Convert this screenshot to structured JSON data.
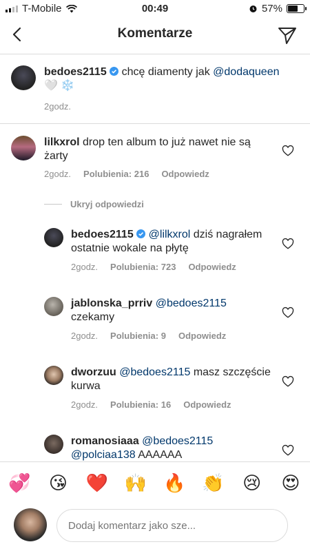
{
  "status_bar": {
    "carrier": "T-Mobile",
    "time": "00:49",
    "battery": "57%"
  },
  "header": {
    "title": "Komentarze"
  },
  "caption": {
    "username": "bedoes2115",
    "text": "chcę diamenty jak",
    "mention": "@dodaqueen",
    "emojis": "🤍 ❄️",
    "time": "2godz."
  },
  "labels": {
    "likes": "Polubienia:",
    "reply": "Odpowiedz"
  },
  "comment": {
    "username": "lilkxrol",
    "text": "drop ten album to już nawet nie są żarty",
    "time": "2godz.",
    "likes": "216"
  },
  "hide_replies": "Ukryj odpowiedzi",
  "replies": [
    {
      "username": "bedoes2115",
      "mention": "@lilkxrol",
      "text": "dziś nagrałem ostatnie wokale na płytę",
      "time": "2godz.",
      "likes": "723"
    },
    {
      "username": "jablonska_prriv",
      "mention": "@bedoes2115",
      "text": "czekamy",
      "time": "2godz.",
      "likes": "9"
    },
    {
      "username": "dworzuu",
      "mention": "@bedoes2115",
      "text": "masz szczęście kurwa",
      "time": "2godz.",
      "likes": "16"
    },
    {
      "username": "romanosiaaa",
      "mention": "@bedoes2115",
      "mention2": "@polciaa138",
      "text": "AAAAAA"
    }
  ],
  "emoji_bar": [
    "💞",
    "😘",
    "❤️",
    "🙌",
    "🔥",
    "👏",
    "😢",
    "😍"
  ],
  "comment_input": {
    "placeholder": "Dodaj komentarz jako sze..."
  },
  "colors": {
    "mention": "#00376b",
    "verified": "#3897f0",
    "meta": "#8e8e8e",
    "divider": "#dbdbdb"
  }
}
